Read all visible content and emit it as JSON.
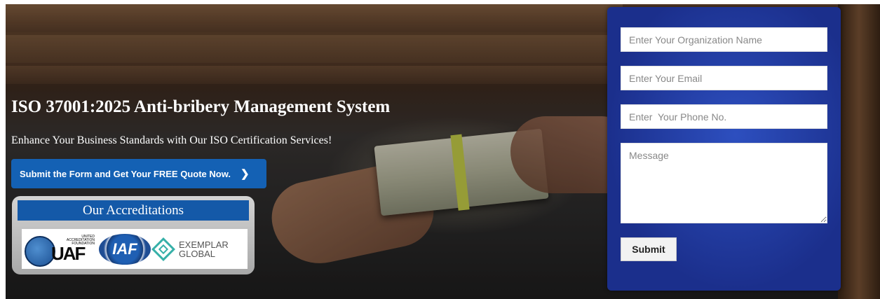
{
  "hero": {
    "title": "ISO 37001:2025 Anti-bribery Management System",
    "subtitle": "Enhance Your Business Standards with Our ISO Certification Services!",
    "cta_label": "Submit the Form and Get Your FREE Quote Now.",
    "cta_icon": "chevron-right-icon"
  },
  "accreditations": {
    "heading": "Our Accreditations",
    "logos": {
      "uaf": {
        "text": "UAF",
        "small": "UNITED ACCREDITATION FOUNDATION"
      },
      "iaf": {
        "text": "IAF"
      },
      "exemplar": {
        "line1": "EXEMPLAR",
        "line2": "GLOBAL"
      }
    }
  },
  "form": {
    "org_placeholder": "Enter Your Organization Name",
    "email_placeholder": "Enter Your Email",
    "phone_placeholder": "Enter  Your Phone No.",
    "message_placeholder": "Message",
    "submit_label": "Submit"
  },
  "colors": {
    "cta_bg": "#1461b4",
    "panel_bg": "#1b2f8c",
    "accred_head_bg": "#1459a8"
  }
}
